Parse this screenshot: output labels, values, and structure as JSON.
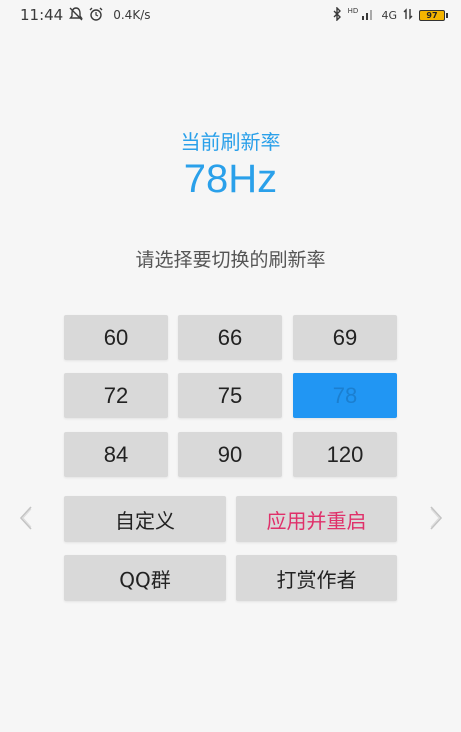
{
  "status_bar": {
    "time": "11:44",
    "speed": "0.4K/s",
    "network_label": "4G",
    "hd_label": "HD",
    "battery_level": "97"
  },
  "header": {
    "current_label": "当前刷新率",
    "current_value": "78Hz",
    "prompt": "请选择要切换的刷新率"
  },
  "rates": [
    {
      "label": "60",
      "selected": false
    },
    {
      "label": "66",
      "selected": false
    },
    {
      "label": "69",
      "selected": false
    },
    {
      "label": "72",
      "selected": false
    },
    {
      "label": "75",
      "selected": false
    },
    {
      "label": "78",
      "selected": true
    },
    {
      "label": "84",
      "selected": false
    },
    {
      "label": "90",
      "selected": false
    },
    {
      "label": "120",
      "selected": false
    }
  ],
  "actions": {
    "custom_label": "自定义",
    "apply_label": "应用并重启",
    "qq_label": "QQ群",
    "donate_label": "打赏作者"
  },
  "colors": {
    "accent": "#2aa0ea",
    "selected": "#2196f3",
    "danger": "#e0306a",
    "button": "#d9d9d9"
  }
}
